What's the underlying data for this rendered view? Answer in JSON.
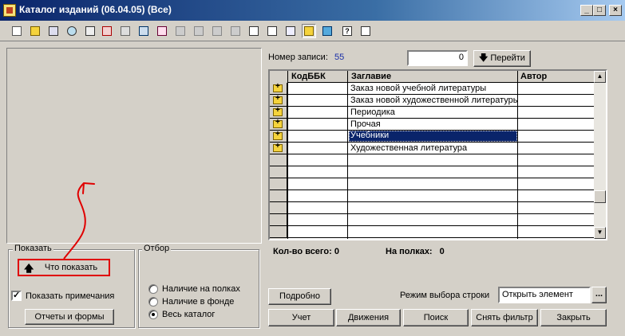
{
  "window": {
    "title": "Каталог изданий (06.04.05) (Все)",
    "minimize": "_",
    "maximize": "□",
    "close": "×"
  },
  "toolbar": {
    "icons": [
      "new-icon",
      "folder-icon",
      "edit-icon",
      "find-icon",
      "mark-icon",
      "delete-icon",
      "copy-icon",
      "move-icon",
      "sort-icon",
      "filter-icon",
      "cancel-filter-icon",
      "tree-icon",
      "list-icon",
      "properties-icon",
      "print-icon",
      "hierarchy-icon",
      "grid-icon",
      "help-icon",
      "pointer-help-icon"
    ]
  },
  "record": {
    "label": "Номер записи:",
    "number": "55",
    "goto_value": "0",
    "goto_button": "Перейти"
  },
  "grid": {
    "headers": [
      "КодББК",
      "Заглавие",
      "Автор"
    ],
    "rows": [
      {
        "code": "",
        "title": "Заказ новой учебной литературы",
        "author": "",
        "folder": true
      },
      {
        "code": "",
        "title": "Заказ новой художественной литературы",
        "author": "",
        "folder": true
      },
      {
        "code": "",
        "title": "Периодика",
        "author": "",
        "folder": true
      },
      {
        "code": "",
        "title": "Прочая",
        "author": "",
        "folder": true
      },
      {
        "code": "",
        "title": "Учебники",
        "author": "",
        "folder": true,
        "selected": true
      },
      {
        "code": "",
        "title": "Художественная литература",
        "author": "",
        "folder": true
      }
    ]
  },
  "totals": {
    "count_label": "Кол-во всего:",
    "count_value": "0",
    "shelf_label": "На полках:",
    "shelf_value": "0"
  },
  "show": {
    "group_label": "Показать",
    "what_button": "Что показать",
    "show_notes_label": "Показать примечания",
    "show_notes_checked": true,
    "reports_button": "Отчеты и формы"
  },
  "filter": {
    "group_label": "Отбор",
    "options": [
      "Наличие на полках",
      "Наличие в фонде",
      "Весь каталог"
    ],
    "selected_index": 2
  },
  "mode": {
    "label": "Режим выбора строки",
    "value": "Открыть элемент",
    "ellipsis": "..."
  },
  "buttons": {
    "details": "Подробно",
    "accounting": "Учет",
    "movements": "Движения",
    "search": "Поиск",
    "reset_filter": "Снять фильтр",
    "close": "Закрыть"
  },
  "colors": {
    "annotation": "#e00000",
    "selection": "#0a246a",
    "record_number": "#1a2fa8"
  }
}
